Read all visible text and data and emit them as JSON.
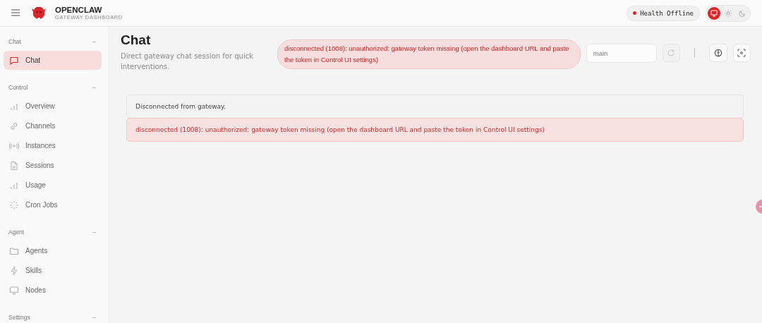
{
  "header": {
    "brand": "OPENCLAW",
    "subtitle": "GATEWAY DASHBOARD",
    "health": {
      "label": "Health Offline",
      "online": false
    },
    "theme_modes": [
      {
        "kind": "system",
        "selected": true
      },
      {
        "kind": "light",
        "selected": false
      },
      {
        "kind": "dark",
        "selected": false
      }
    ]
  },
  "sidebar": {
    "groups": [
      {
        "title": "Chat",
        "expanded": true,
        "items": [
          {
            "label": "Chat",
            "kind": "chat",
            "selected": true
          }
        ]
      },
      {
        "title": "Control",
        "expanded": true,
        "items": [
          {
            "label": "Overview",
            "kind": "bars",
            "selected": false
          },
          {
            "label": "Channels",
            "kind": "link",
            "selected": false
          },
          {
            "label": "Instances",
            "kind": "radio",
            "selected": false
          },
          {
            "label": "Sessions",
            "kind": "doc",
            "selected": false
          },
          {
            "label": "Usage",
            "kind": "bars",
            "selected": false
          },
          {
            "label": "Cron Jobs",
            "kind": "spinner",
            "selected": false
          }
        ]
      },
      {
        "title": "Agent",
        "expanded": true,
        "items": [
          {
            "label": "Agents",
            "kind": "folder",
            "selected": false
          },
          {
            "label": "Skills",
            "kind": "bolt",
            "selected": false
          },
          {
            "label": "Nodes",
            "kind": "monitor",
            "selected": false
          }
        ]
      },
      {
        "title": "Settings",
        "expanded": true
      }
    ]
  },
  "page": {
    "title": "Chat",
    "subtitle": "Direct gateway chat session for quick interventions.",
    "error_pill": "disconnected (1008): unauthorized: gateway token missing (open the dashboard URL and paste the token in Control UI settings)",
    "session_field": {
      "value": "main"
    }
  },
  "messages": [
    {
      "kind": "info",
      "text": "Disconnected from gateway."
    },
    {
      "kind": "error",
      "text": "disconnected (1008): unauthorized: gateway token missing (open the dashboard URL and paste the token in Control UI settings)"
    }
  ]
}
